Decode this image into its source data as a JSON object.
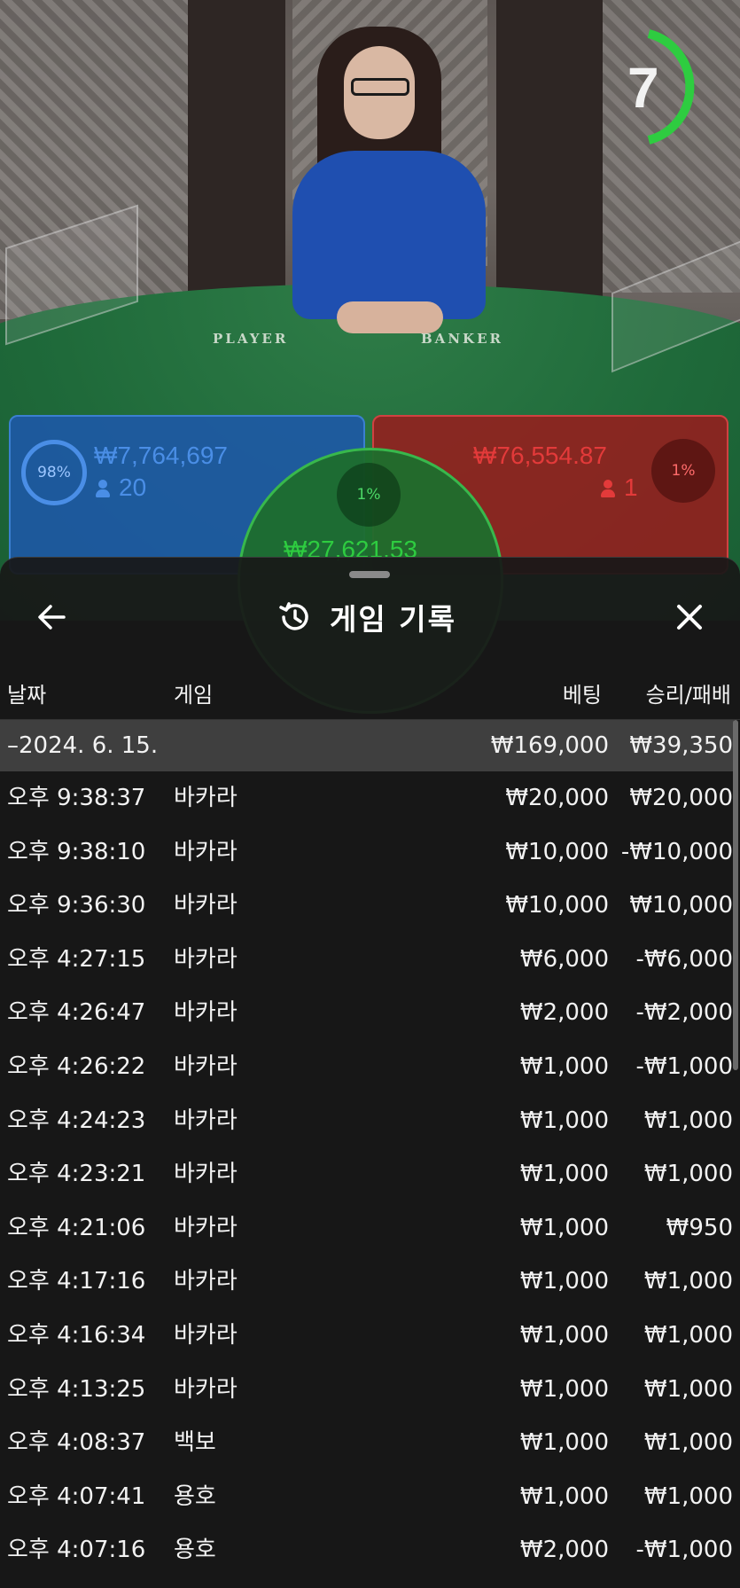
{
  "timer": {
    "value": "7"
  },
  "table": {
    "player_label": "PLAYER",
    "banker_label": "BANKER"
  },
  "bets": {
    "player": {
      "percent": "98%",
      "amount": "₩7,764,697",
      "count": "20"
    },
    "banker": {
      "percent": "1%",
      "amount": "₩76,554.87",
      "count": "1"
    },
    "tie": {
      "percent": "1%",
      "amount": "₩27,621.53"
    }
  },
  "history": {
    "title": "게임 기록",
    "columns": {
      "date": "날짜",
      "game": "게임",
      "bet": "베팅",
      "result": "승리/패배"
    },
    "summary": {
      "date": "–2024. 6. 15.",
      "bet": "₩169,000",
      "result": "₩39,350"
    },
    "rows": [
      {
        "date": "오후 9:38:37",
        "game": "바카라",
        "bet": "₩20,000",
        "result": "₩20,000"
      },
      {
        "date": "오후 9:38:10",
        "game": "바카라",
        "bet": "₩10,000",
        "result": "-₩10,000"
      },
      {
        "date": "오후 9:36:30",
        "game": "바카라",
        "bet": "₩10,000",
        "result": "₩10,000"
      },
      {
        "date": "오후 4:27:15",
        "game": "바카라",
        "bet": "₩6,000",
        "result": "-₩6,000"
      },
      {
        "date": "오후 4:26:47",
        "game": "바카라",
        "bet": "₩2,000",
        "result": "-₩2,000"
      },
      {
        "date": "오후 4:26:22",
        "game": "바카라",
        "bet": "₩1,000",
        "result": "-₩1,000"
      },
      {
        "date": "오후 4:24:23",
        "game": "바카라",
        "bet": "₩1,000",
        "result": "₩1,000"
      },
      {
        "date": "오후 4:23:21",
        "game": "바카라",
        "bet": "₩1,000",
        "result": "₩1,000"
      },
      {
        "date": "오후 4:21:06",
        "game": "바카라",
        "bet": "₩1,000",
        "result": "₩950"
      },
      {
        "date": "오후 4:17:16",
        "game": "바카라",
        "bet": "₩1,000",
        "result": "₩1,000"
      },
      {
        "date": "오후 4:16:34",
        "game": "바카라",
        "bet": "₩1,000",
        "result": "₩1,000"
      },
      {
        "date": "오후 4:13:25",
        "game": "바카라",
        "bet": "₩1,000",
        "result": "₩1,000"
      },
      {
        "date": "오후 4:08:37",
        "game": "백보",
        "bet": "₩1,000",
        "result": "₩1,000"
      },
      {
        "date": "오후 4:07:41",
        "game": "용호",
        "bet": "₩1,000",
        "result": "₩1,000"
      },
      {
        "date": "오후 4:07:16",
        "game": "용호",
        "bet": "₩2,000",
        "result": "-₩1,000"
      }
    ]
  },
  "colors": {
    "player": "#1e58aa",
    "banker": "#961e1e",
    "tie": "#1e6e2d",
    "sheet": "#181818"
  }
}
